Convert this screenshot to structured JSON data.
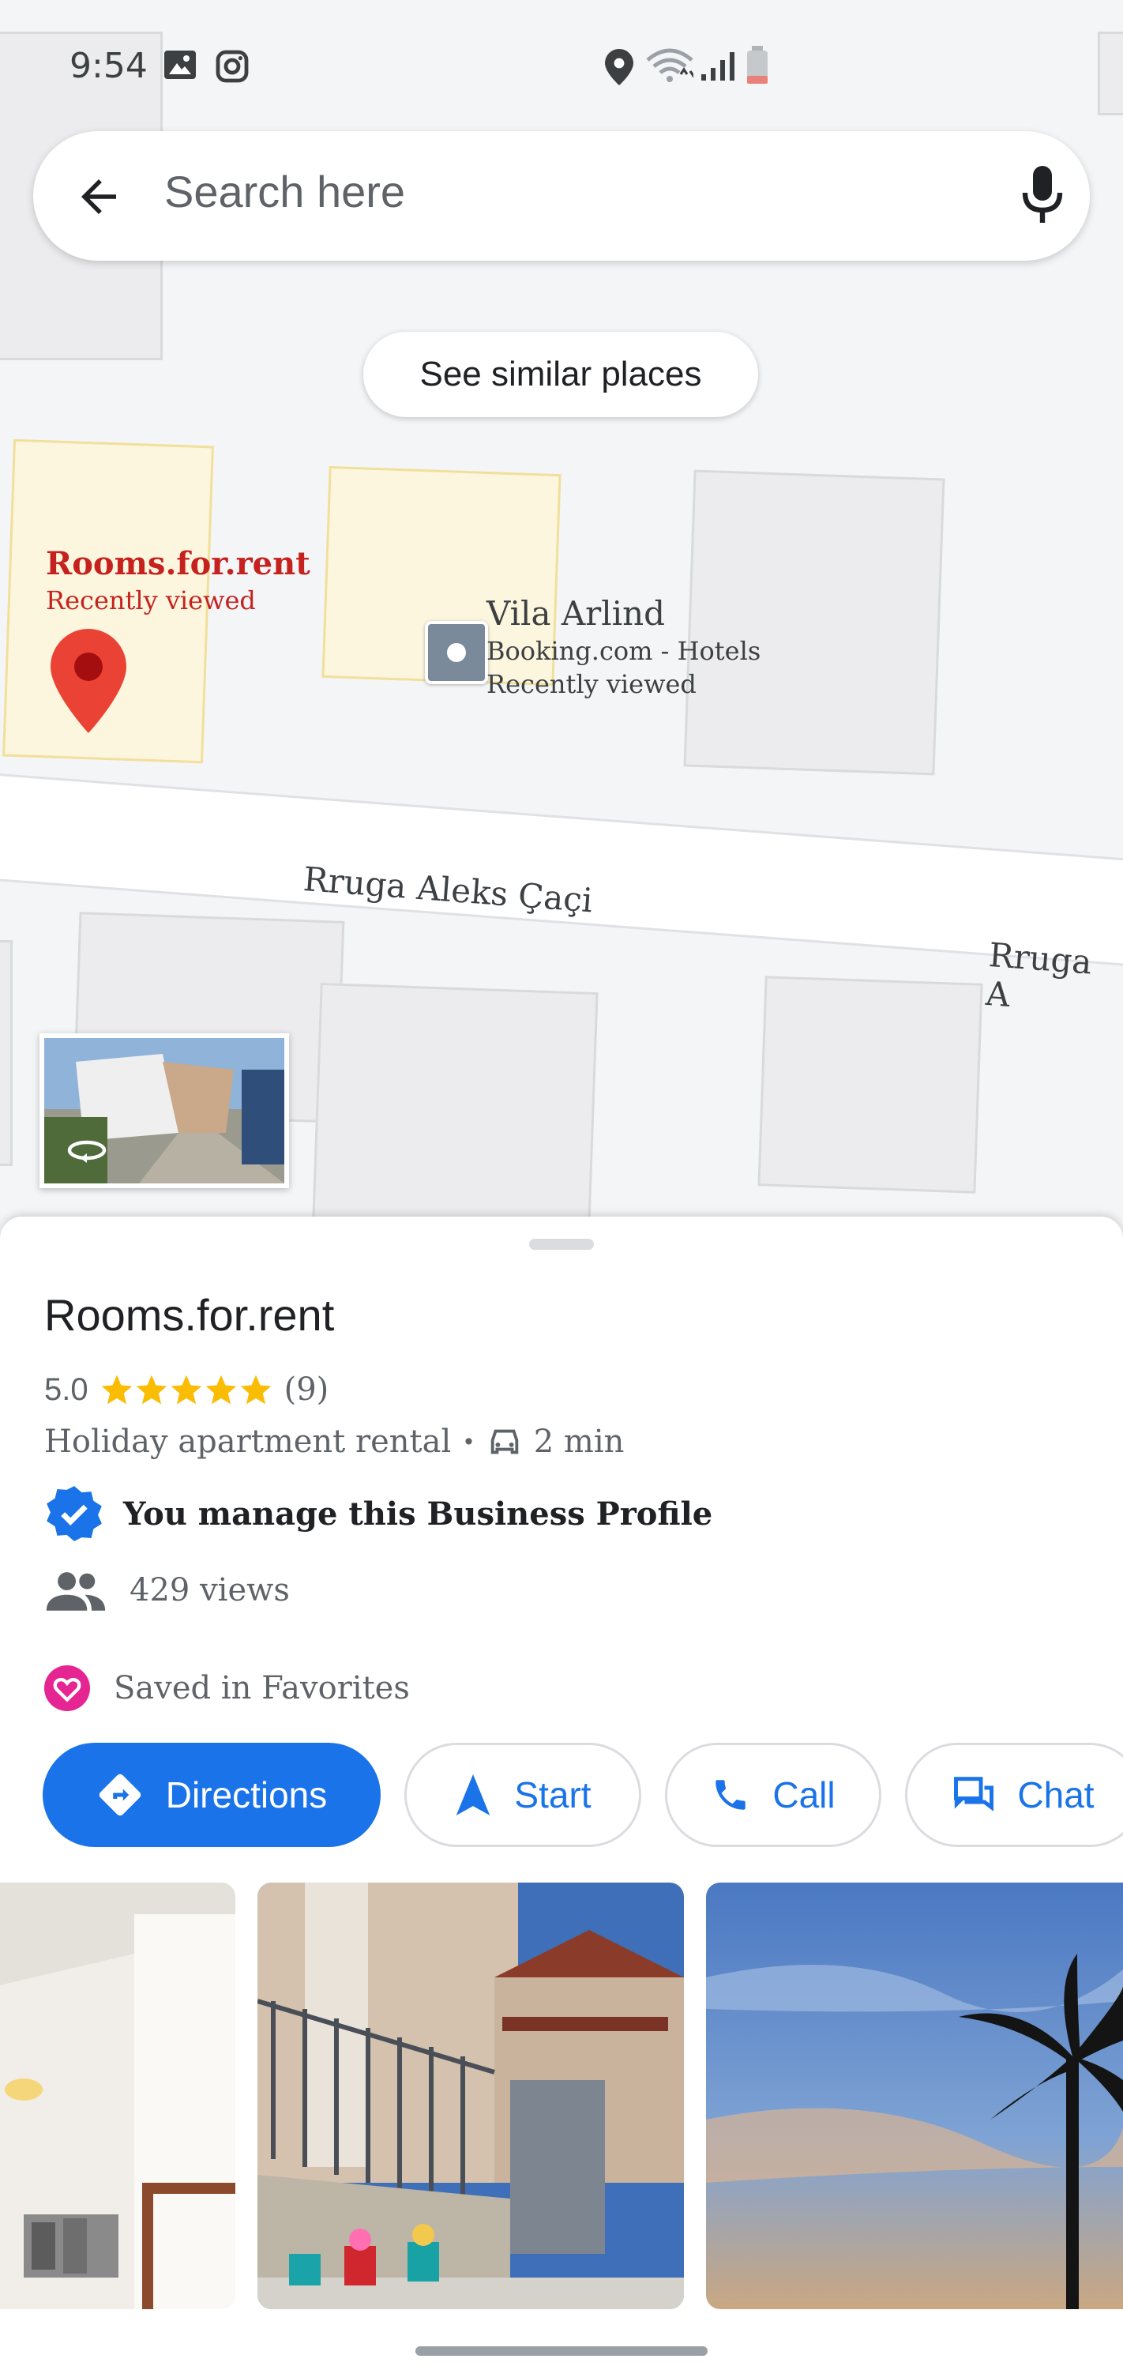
{
  "status_bar": {
    "time": "9:54"
  },
  "search": {
    "placeholder": "Search here"
  },
  "map": {
    "see_similar_label": "See similar places",
    "places": [
      {
        "name": "Rooms.for.rent",
        "subtitle": "Recently viewed"
      },
      {
        "name": "Vila Arlind",
        "category": "Booking.com - Hotels",
        "subtitle": "Recently viewed"
      }
    ],
    "roads": [
      "Rruga Aleks Çaçi",
      "Rruga A"
    ]
  },
  "place": {
    "title": "Rooms.for.rent",
    "rating": "5.0",
    "stars": 5,
    "reviews": "(9)",
    "category": "Holiday apartment rental",
    "separator": "•",
    "drive_time": "2 min",
    "manage_text": "You manage this Business Profile",
    "views": "429 views",
    "saved": "Saved in Favorites"
  },
  "actions": {
    "directions": "Directions",
    "start": "Start",
    "call": "Call",
    "chat": "Chat"
  },
  "colors": {
    "accent": "#1a73e8",
    "pin_red": "#ea4335",
    "label_red": "#c5221f",
    "star": "#fbbc04",
    "favorite_pink": "#e52592"
  }
}
